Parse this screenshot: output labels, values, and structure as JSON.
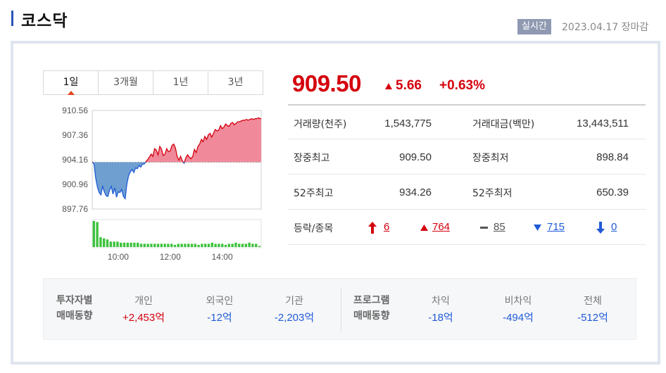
{
  "header": {
    "title": "코스닥",
    "realtime_badge": "실시간",
    "date_status": "2023.04.17 장마감"
  },
  "tabs": [
    {
      "label": "1일",
      "active": true
    },
    {
      "label": "3개월",
      "active": false
    },
    {
      "label": "1년",
      "active": false
    },
    {
      "label": "3년",
      "active": false
    }
  ],
  "quote": {
    "price": "909.50",
    "change": "5.66",
    "change_pct": "+0.63%",
    "direction": "up"
  },
  "stats": {
    "volume_label": "거래량(천주)",
    "volume_value": "1,543,775",
    "amount_label": "거래대금(백만)",
    "amount_value": "13,443,511",
    "high_label": "장중최고",
    "high_value": "909.50",
    "low_label": "장중최저",
    "low_value": "898.84",
    "w52_high_label": "52주최고",
    "w52_high_value": "934.26",
    "w52_low_label": "52주최저",
    "w52_low_value": "650.39",
    "advdec_label": "등락/종목",
    "upper_limit": "6",
    "rise": "764",
    "flat": "85",
    "fall": "715",
    "lower_limit": "0"
  },
  "flows": {
    "investor_title_1": "투자자별",
    "investor_title_2": "매매동향",
    "individual_label": "개인",
    "individual_value": "+2,453억",
    "foreign_label": "외국인",
    "foreign_value": "-12억",
    "institution_label": "기관",
    "institution_value": "-2,203억",
    "program_title_1": "프로그램",
    "program_title_2": "매매동향",
    "arbitrage_label": "차익",
    "arbitrage_value": "-18억",
    "nonarb_label": "비차익",
    "nonarb_value": "-494억",
    "total_label": "전체",
    "total_value": "-512억"
  },
  "colors": {
    "up": "#d4000d",
    "down": "#1f5ad8",
    "up_fill": "#f08a9a",
    "down_fill": "#6e9fd0",
    "volume": "#3cc23c",
    "accent_bar": "#2855b8"
  },
  "chart_data": {
    "type": "area",
    "y_ticks": [
      "910.56",
      "907.36",
      "904.16",
      "900.96",
      "897.76"
    ],
    "x_ticks": [
      "10:00",
      "12:00",
      "14:00"
    ],
    "ylim": [
      897.76,
      910.56
    ],
    "baseline": 903.84,
    "x_range_minutes": [
      540,
      930
    ],
    "series": {
      "t": [
        540,
        544,
        548,
        552,
        556,
        560,
        564,
        568,
        572,
        576,
        580,
        584,
        588,
        592,
        596,
        600,
        604,
        608,
        612,
        616,
        620,
        624,
        628,
        632,
        636,
        640,
        644,
        648,
        652,
        656,
        660,
        664,
        668,
        672,
        676,
        680,
        684,
        688,
        692,
        696,
        700,
        704,
        708,
        712,
        716,
        720,
        724,
        728,
        732,
        736,
        740,
        744,
        748,
        752,
        756,
        760,
        764,
        768,
        772,
        776,
        780,
        784,
        788,
        792,
        796,
        800,
        804,
        808,
        812,
        816,
        820,
        824,
        828,
        832,
        836,
        840,
        844,
        848,
        852,
        856,
        860,
        864,
        868,
        872,
        876,
        880,
        884,
        888,
        892,
        896,
        900,
        904,
        908,
        912,
        916,
        920,
        924,
        928,
        930
      ],
      "v": [
        903.9,
        903.6,
        901.8,
        900.6,
        899.9,
        899.6,
        900.7,
        900.0,
        899.5,
        899.4,
        900.2,
        900.7,
        899.7,
        900.5,
        899.3,
        900.0,
        899.9,
        900.3,
        899.4,
        899.1,
        901.0,
        902.1,
        902.6,
        902.9,
        902.5,
        903.1,
        903.0,
        903.4,
        903.2,
        903.6,
        903.6,
        903.9,
        904.2,
        904.5,
        904.9,
        904.6,
        905.6,
        905.4,
        904.8,
        905.9,
        905.5,
        904.7,
        904.9,
        905.6,
        905.2,
        905.3,
        906.0,
        906.2,
        905.7,
        904.6,
        904.1,
        904.6,
        904.0,
        903.7,
        904.4,
        904.8,
        904.5,
        904.3,
        904.6,
        905.5,
        905.1,
        905.9,
        906.2,
        906.8,
        906.5,
        907.2,
        906.8,
        907.4,
        907.6,
        907.1,
        907.6,
        908.1,
        907.9,
        908.0,
        908.6,
        908.2,
        908.4,
        908.8,
        908.6,
        908.5,
        908.9,
        909.0,
        908.7,
        908.9,
        909.1,
        909.1,
        909.2,
        909.3,
        909.3,
        909.4,
        909.3,
        909.4,
        909.5,
        909.4,
        909.5,
        909.5,
        909.6,
        909.5,
        909.5
      ]
    },
    "volume": [
      24,
      23,
      9,
      8,
      7,
      5,
      5,
      5,
      4,
      4,
      4,
      4,
      4,
      4,
      3,
      3,
      3,
      3,
      3,
      3,
      3,
      3,
      3,
      3,
      2,
      3,
      3,
      3,
      3,
      3,
      3,
      2,
      3,
      3,
      3,
      4,
      3,
      3,
      3,
      2,
      3,
      3,
      4,
      3,
      3,
      3,
      4,
      3,
      3,
      1
    ]
  }
}
